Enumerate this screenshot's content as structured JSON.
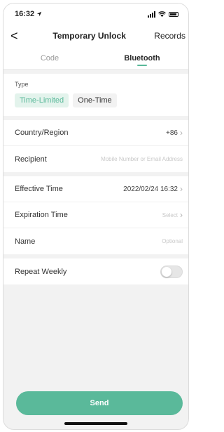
{
  "status": {
    "time": "16:32"
  },
  "header": {
    "back": "<",
    "title": "Temporary Unlock",
    "records": "Records"
  },
  "tabs": [
    {
      "label": "Code"
    },
    {
      "label": "Bluetooth"
    }
  ],
  "type": {
    "label": "Type",
    "options": [
      {
        "label": "Time-Limited"
      },
      {
        "label": "One-Time"
      }
    ]
  },
  "fields": {
    "country": {
      "label": "Country/Region",
      "value": "+86"
    },
    "recipient": {
      "label": "Recipient",
      "placeholder": "Mobile Number or Email Address"
    },
    "effective": {
      "label": "Effective Time",
      "value": "2022/02/24 16:32"
    },
    "expiration": {
      "label": "Expiration Time",
      "value": "Select"
    },
    "name": {
      "label": "Name",
      "placeholder": "Optional"
    },
    "repeat": {
      "label": "Repeat Weekly",
      "enabled": false
    }
  },
  "send_label": "Send",
  "colors": {
    "accent": "#5ab99a",
    "chip_bg": "#e3f3ec"
  }
}
